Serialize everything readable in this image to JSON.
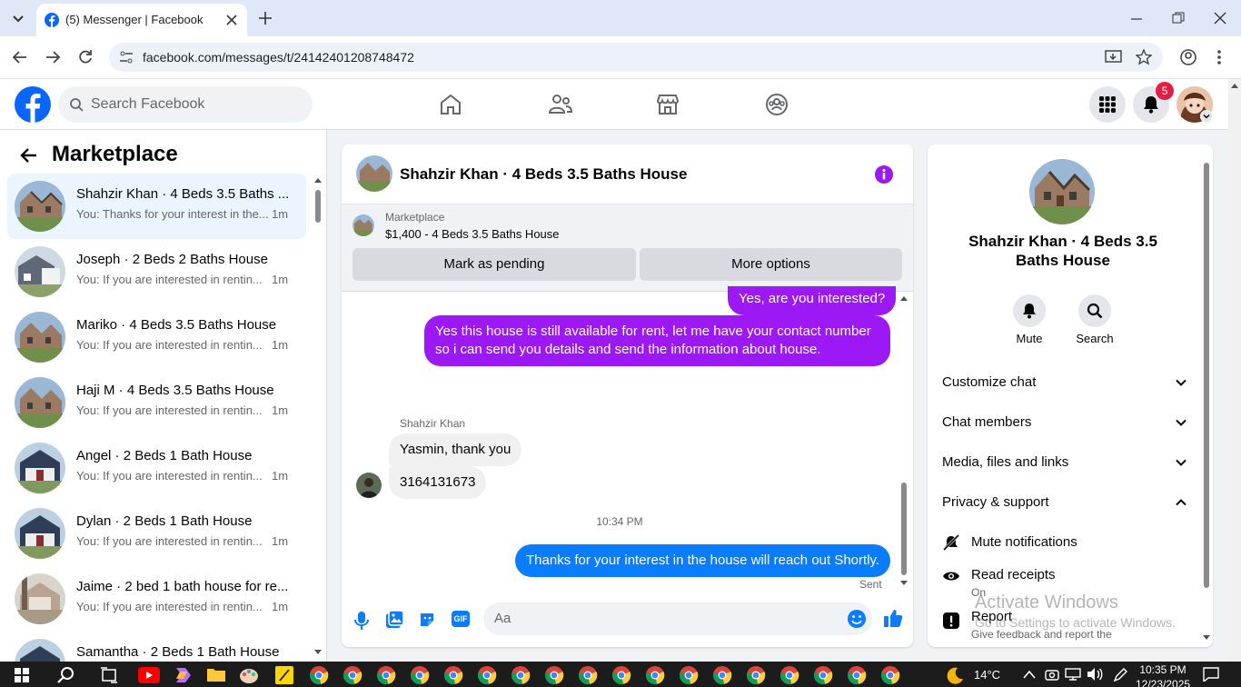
{
  "browser": {
    "tab_title": "(5) Messenger | Facebook",
    "url": "facebook.com/messages/t/24142401208748472"
  },
  "fb": {
    "search_placeholder": "Search Facebook",
    "notification_count": "5"
  },
  "left": {
    "header": "Marketplace",
    "conversations": [
      {
        "name": "Shahzir Khan · 4 Beds 3.5 Baths ...",
        "snippet": "You: Thanks for your interest in the...",
        "time": "1m"
      },
      {
        "name": "Joseph · 2 Beds 2 Baths House",
        "snippet": "You: If you are interested in rentin...",
        "time": "1m"
      },
      {
        "name": "Mariko · 4 Beds 3.5 Baths House",
        "snippet": "You: If you are interested in rentin...",
        "time": "1m"
      },
      {
        "name": "Haji M · 4 Beds 3.5 Baths House",
        "snippet": "You: If you are interested in rentin...",
        "time": "1m"
      },
      {
        "name": "Angel · 2 Beds 1 Bath House",
        "snippet": "You: If you are interested in rentin...",
        "time": "1m"
      },
      {
        "name": "Dylan · 2 Beds 1 Bath House",
        "snippet": "You: If you are interested in rentin...",
        "time": "1m"
      },
      {
        "name": "Jaime · 2 bed 1 bath house for re...",
        "snippet": "You: If you are interested in rentin...",
        "time": "1m"
      },
      {
        "name": "Samantha · 2 Beds 1 Bath House",
        "snippet": "",
        "time": ""
      }
    ]
  },
  "chat": {
    "title": "Shahzir Khan · 4 Beds 3.5 Baths House",
    "listing_label": "Marketplace",
    "listing_price": "$1,400 - 4 Beds 3.5 Baths House",
    "mark_pending": "Mark as pending",
    "more_options": "More options",
    "messages": {
      "m1": "Yes, are you interested?",
      "m2": "Yes this house is still available for rent, let me have your contact number so i can send you details and send the information about house.",
      "sender": "Shahzir Khan",
      "m3": "Yasmin, thank you",
      "m4": "3164131673",
      "timestamp": "10:34 PM",
      "m5": "Thanks for your interest in the house will reach out Shortly.",
      "status": "Sent"
    },
    "composer_placeholder": "Aa",
    "gif_label": "GIF"
  },
  "right": {
    "title": "Shahzir Khan · 4 Beds 3.5 Baths House",
    "mute": "Mute",
    "search": "Search",
    "customize": "Customize chat",
    "members": "Chat members",
    "media": "Media, files and links",
    "privacy": "Privacy & support",
    "mute_notifications": "Mute notifications",
    "read_receipts": "Read receipts",
    "read_receipts_state": "On",
    "report": "Report",
    "report_desc": "Give feedback and report the",
    "watermark_title": "Activate Windows",
    "watermark_sub": "Go to Settings to activate Windows."
  },
  "taskbar": {
    "temperature": "14°C",
    "time": "10:35 PM",
    "date": "12/23/2025"
  },
  "colors": {
    "fb_blue": "#0866ff",
    "purple": "#9c19f5",
    "messenger_blue": "#0a7cff",
    "notification_red": "#e41e3f"
  }
}
